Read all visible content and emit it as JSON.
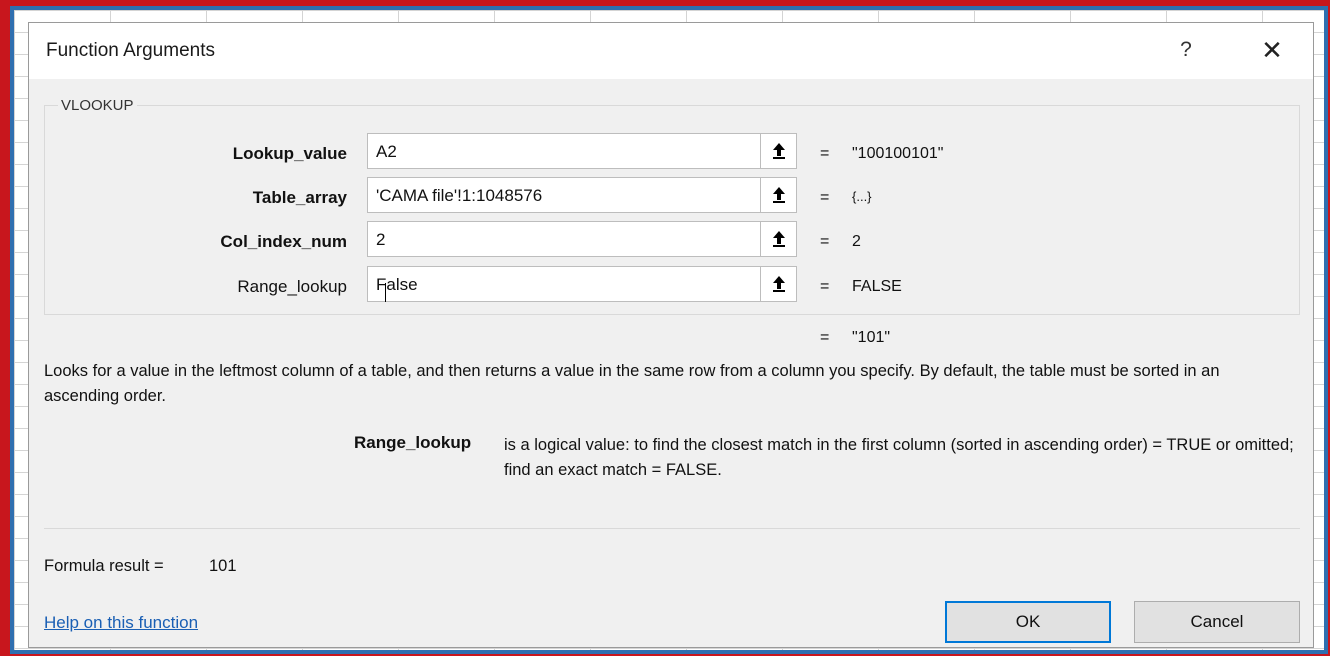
{
  "dialog": {
    "title": "Function Arguments",
    "help_glyph": "?",
    "close_glyph": "✕",
    "function_name": "VLOOKUP"
  },
  "args": [
    {
      "label": "Lookup_value",
      "value": "A2",
      "result": "\"100100101\""
    },
    {
      "label": "Table_array",
      "value": "'CAMA file'!1:1048576",
      "result": "{...}"
    },
    {
      "label": "Col_index_num",
      "value": "2",
      "result": "2"
    },
    {
      "label": "Range_lookup",
      "value": "False",
      "result": "FALSE"
    }
  ],
  "equals_sign": "=",
  "overall_result": "\"101\"",
  "description": "Looks for a value in the leftmost column of a table, and then returns a value in the same row from a column you specify. By default, the table must be sorted in an ascending order.",
  "arg_help": {
    "name": "Range_lookup",
    "text": "is a logical value: to find the closest match in the first column (sorted in ascending order) = TRUE or omitted; find an exact match = FALSE."
  },
  "formula_result": {
    "label": "Formula result =",
    "value": "101"
  },
  "help_link": "Help on this function",
  "buttons": {
    "ok": "OK",
    "cancel": "Cancel"
  }
}
